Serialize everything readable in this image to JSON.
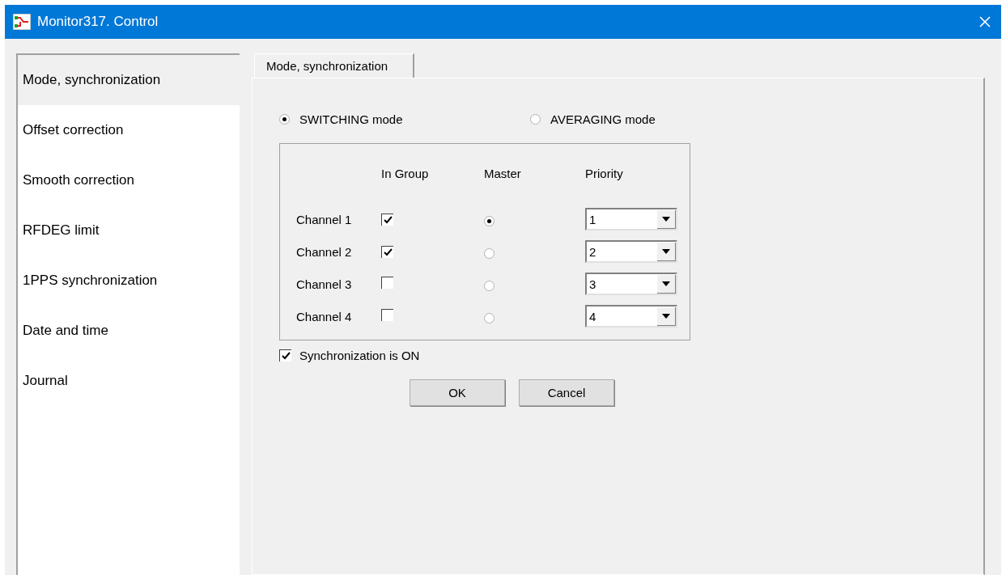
{
  "window": {
    "title": "Monitor317. Control"
  },
  "sidebar": {
    "items": [
      {
        "label": "Mode, synchronization",
        "selected": true
      },
      {
        "label": "Offset correction",
        "selected": false
      },
      {
        "label": "Smooth correction",
        "selected": false
      },
      {
        "label": "RFDEG limit",
        "selected": false
      },
      {
        "label": "1PPS synchronization",
        "selected": false
      },
      {
        "label": "Date and time",
        "selected": false
      },
      {
        "label": "Journal",
        "selected": false
      }
    ]
  },
  "tabs": [
    {
      "label": "Mode, synchronization",
      "selected": true
    }
  ],
  "modes": [
    {
      "label": "SWITCHING mode",
      "selected": true
    },
    {
      "label": "AVERAGING mode",
      "selected": false
    }
  ],
  "channel_table": {
    "columns": [
      "In Group",
      "Master",
      "Priority"
    ],
    "rows": [
      {
        "name": "Channel 1",
        "in_group": true,
        "master": true,
        "priority": "1"
      },
      {
        "name": "Channel 2",
        "in_group": true,
        "master": false,
        "priority": "2"
      },
      {
        "name": "Channel 3",
        "in_group": false,
        "master": false,
        "priority": "3"
      },
      {
        "name": "Channel 4",
        "in_group": false,
        "master": false,
        "priority": "4"
      }
    ]
  },
  "sync": {
    "label": "Synchronization is ON",
    "checked": true
  },
  "buttons": [
    "OK",
    "Cancel"
  ]
}
